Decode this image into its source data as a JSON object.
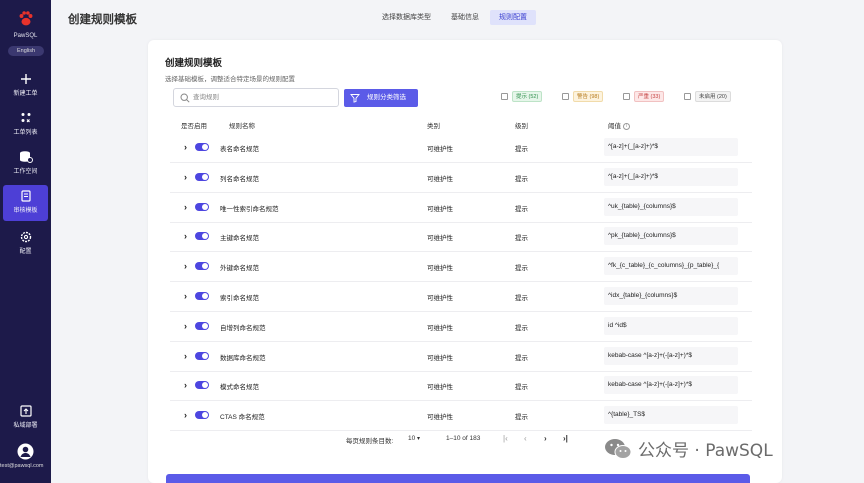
{
  "sidebar": {
    "app_name": "PawSQL",
    "lang": "English",
    "items": [
      {
        "label": "新建工单",
        "icon": "plus-icon"
      },
      {
        "label": "工单列表",
        "icon": "list-icon"
      },
      {
        "label": "工作空间",
        "icon": "database-icon"
      },
      {
        "label": "审核模板",
        "icon": "template-icon"
      },
      {
        "label": "配置",
        "icon": "gear-icon"
      },
      {
        "label": "私域部署",
        "icon": "deploy-icon"
      }
    ],
    "email": "test@pawsql.com"
  },
  "header": {
    "title": "创建规则模板",
    "steps": [
      "选择数据库类型",
      "基础信息",
      "规则配置"
    ],
    "active_step": "规则配置"
  },
  "card": {
    "title": "创建规则模板",
    "subtitle": "选择基础模板，调整适合特定场景的规则配置",
    "search_placeholder": "查询规则",
    "filter_button": "规则分类筛选",
    "badges": [
      {
        "label": "提示 (52)",
        "color": "#2f8f4c"
      },
      {
        "label": "警告 (98)",
        "color": "#b5791a"
      },
      {
        "label": "严重 (33)",
        "color": "#c54545"
      },
      {
        "label": "未启用 (20)",
        "color": "#444444"
      }
    ]
  },
  "table": {
    "columns": [
      "是否启用",
      "规则名称",
      "类别",
      "级别",
      "阈值"
    ],
    "rows": [
      {
        "name": "表名命名规范",
        "category": "可维护性",
        "level": "提示",
        "threshold": "^[a-z]+(_[a-z]+)*$"
      },
      {
        "name": "列名命名规范",
        "category": "可维护性",
        "level": "提示",
        "threshold": "^[a-z]+(_[a-z]+)*$"
      },
      {
        "name": "唯一性索引命名规范",
        "category": "可维护性",
        "level": "提示",
        "threshold": "^uk_{table}_{columns}$"
      },
      {
        "name": "主键命名规范",
        "category": "可维护性",
        "level": "提示",
        "threshold": "^pk_{table}_{columns}$"
      },
      {
        "name": "外键命名规范",
        "category": "可维护性",
        "level": "提示",
        "threshold": "^fk_{c_table}_{c_columns}_{p_table}_{"
      },
      {
        "name": "索引命名规范",
        "category": "可维护性",
        "level": "提示",
        "threshold": "^idx_{table}_{columns}$"
      },
      {
        "name": "自增列命名规范",
        "category": "可维护性",
        "level": "提示",
        "threshold": "id ^id$"
      },
      {
        "name": "数据库命名规范",
        "category": "可维护性",
        "level": "提示",
        "threshold": "kebab-case  ^[a-z]+(-[a-z]+)*$"
      },
      {
        "name": "模式命名规范",
        "category": "可维护性",
        "level": "提示",
        "threshold": "kebab-case  ^[a-z]+(-[a-z]+)*$"
      },
      {
        "name": "CTAS 命名规范",
        "category": "可维护性",
        "level": "提示",
        "threshold": "^{table}_TS$"
      }
    ]
  },
  "pagination": {
    "per_page_label": "每页规则条目数:",
    "per_page_value": "10",
    "range": "1–10 of 183"
  },
  "watermark": "公众号 · PawSQL",
  "colors": {
    "sidebar_bg": "#1d1a4a",
    "accent": "#5b5be8",
    "active_nav": "#4d3fd6"
  }
}
